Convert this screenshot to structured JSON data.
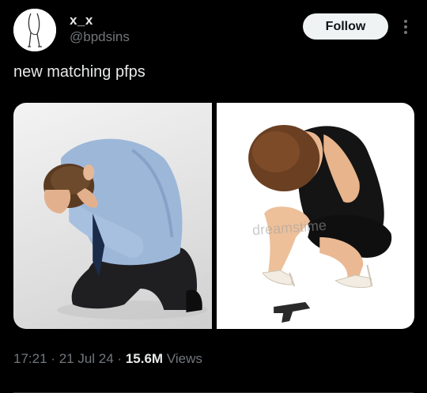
{
  "author": {
    "display_name": "x_x",
    "handle": "@bpdsins",
    "avatar_icon": "sketch-avatar-icon"
  },
  "header": {
    "follow_label": "Follow",
    "more_icon": "more-vertical-icon"
  },
  "tweet": {
    "text": "new matching  pfps"
  },
  "media": {
    "images": [
      {
        "description_icon": "man-kneeling-photo"
      },
      {
        "description_icon": "woman-crouching-photo",
        "watermark": "dreamstime"
      }
    ]
  },
  "meta": {
    "time": "17:21",
    "date": "21 Jul 24",
    "views_count": "15.6M",
    "views_label": "Views",
    "separator": "·"
  },
  "colors": {
    "background": "#000000",
    "text_primary": "#e7e9ea",
    "text_secondary": "#71767b",
    "follow_bg": "#eff3f4"
  }
}
